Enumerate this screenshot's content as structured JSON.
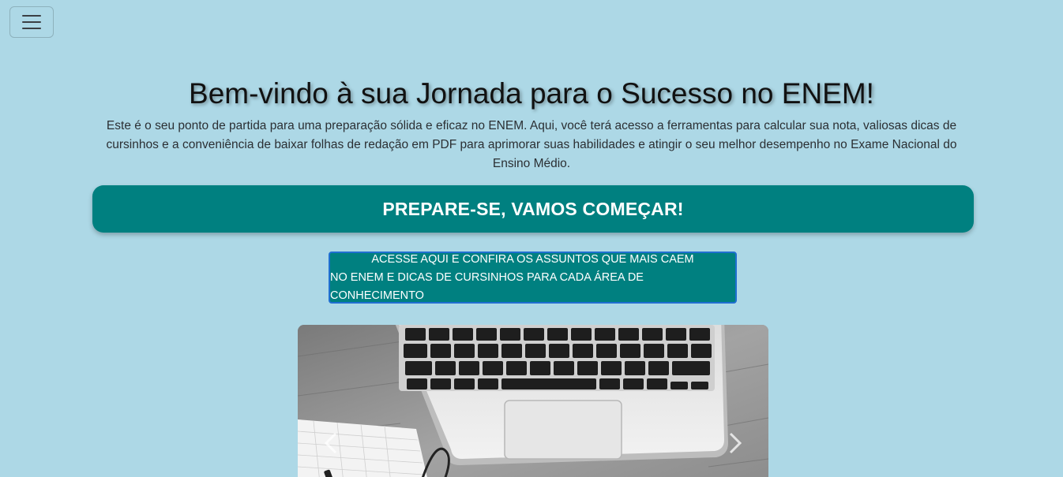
{
  "nav": {
    "menu_icon": "hamburger-menu-icon"
  },
  "hero": {
    "title": "Bem-vindo à sua Jornada para o Sucesso no ENEM!",
    "intro": "Este é o seu ponto de partida para uma preparação sólida e eficaz no ENEM. Aqui, você terá acesso a ferramentas para calcular sua nota, valiosas dicas de cursinhos e a conveniência de baixar folhas de redação em PDF para aprimorar suas habilidades e atingir o seu melhor desempenho no Exame Nacional do Ensino Médio."
  },
  "cta": {
    "banner_label": "PREPARE-SE, VAMOS COMEÇAR!",
    "access_line1": "ACESSE AQUI E CONFIRA OS ASSUNTOS QUE MAIS CAEM",
    "access_line2": "NO ENEM E DICAS DE CURSINHOS PARA CADA ÁREA DE CONHECIMENTO"
  },
  "carousel": {
    "prev_icon": "chevron-left-icon",
    "next_icon": "chevron-right-icon",
    "image_subject": "laptop-and-notebook-photo"
  },
  "colors": {
    "page_background": "#add8e6",
    "accent_teal": "#008080",
    "button_border": "#1f6fd1"
  }
}
